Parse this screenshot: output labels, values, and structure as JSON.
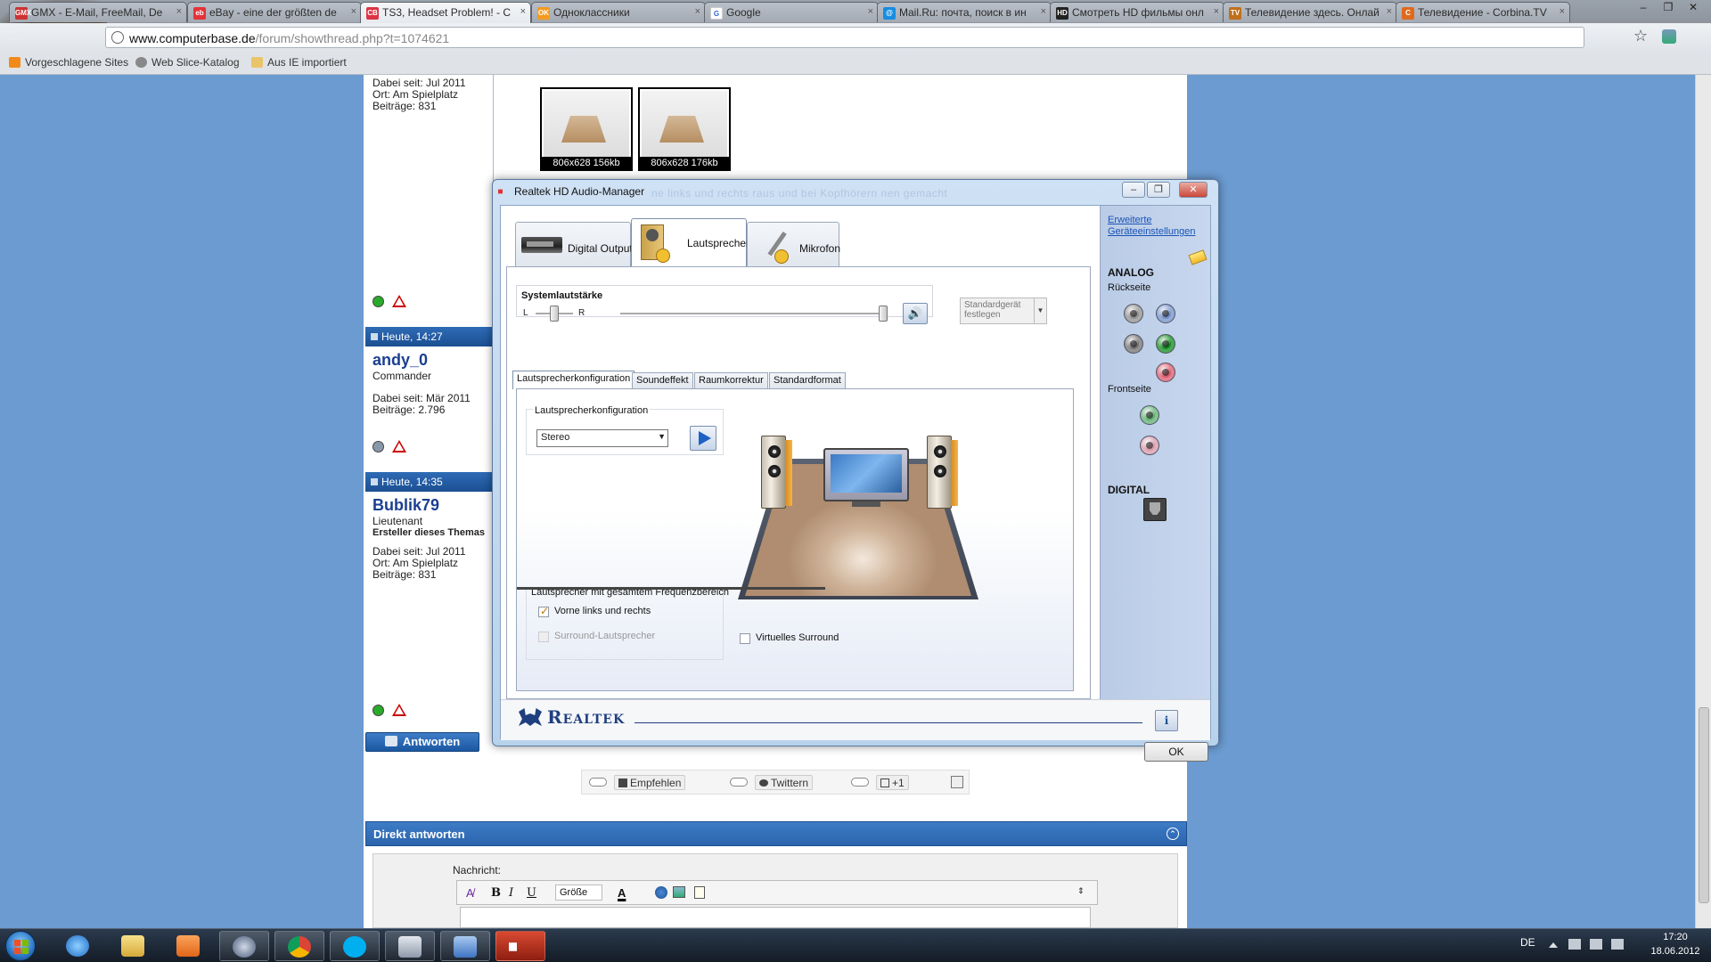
{
  "browser": {
    "tabs": [
      {
        "label": "GMX - E-Mail, FreeMail, De",
        "favicon": "GMX"
      },
      {
        "label": "eBay - eine der größten de",
        "favicon": "eb"
      },
      {
        "label": "TS3, Headset Problem! - C",
        "favicon": "CB"
      },
      {
        "label": "Одноклассники",
        "favicon": "OK"
      },
      {
        "label": "Google",
        "favicon": "G"
      },
      {
        "label": "Mail.Ru: почта, поиск в ин",
        "favicon": "@"
      },
      {
        "label": "Смотреть HD фильмы онл",
        "favicon": "HD"
      },
      {
        "label": "Телевидение здесь. Онлай",
        "favicon": "TV"
      },
      {
        "label": "Телевидение - Corbina.TV",
        "favicon": "C"
      }
    ],
    "close_glyph": "×",
    "url_domain": "www.computerbase.de",
    "url_path": "/forum/showthread.php?t=1074621",
    "bookmarks": [
      "Vorgeschlagene Sites",
      "Web Slice-Katalog",
      "Aus IE importiert"
    ],
    "window_controls": [
      "–",
      "❐",
      "✕"
    ]
  },
  "forum": {
    "post1": {
      "dabei": "Dabei seit: Jul 2011",
      "ort": "Ort: Am Spielplatz",
      "beitraege": "Beiträge: 831"
    },
    "attachments": [
      "806x628 156kb",
      "806x628 176kb"
    ],
    "post2": {
      "time": "Heute, 14:27",
      "name": "andy_0",
      "rank": "Commander",
      "dabei": "Dabei seit: Mär 2011",
      "beitraege": "Beiträge: 2.796"
    },
    "post3": {
      "time": "Heute, 14:35",
      "name": "Bublik79",
      "rank": "Lieutenant",
      "starter": "Ersteller dieses Themas",
      "dabei": "Dabei seit: Jul 2011",
      "ort": "Ort: Am Spielplatz",
      "beitraege": "Beiträge: 831"
    },
    "reply_button": "Antworten",
    "social": {
      "recommend": "Empfehlen",
      "tweet": "Twittern",
      "plusone": "+1"
    },
    "direct_reply": "Direkt antworten",
    "message_label": "Nachricht:",
    "editor": {
      "bold": "B",
      "italic": "I",
      "underline": "U",
      "size": "Größe",
      "color": "A"
    }
  },
  "dialog": {
    "title": "Realtek HD Audio-Manager",
    "ghost_text": "ne links und rechts raus und bei Kopfhörern nen gemacht",
    "tabs": [
      "Digital Output",
      "Lautsprecher",
      "Mikrofon"
    ],
    "volume": {
      "title": "Systemlautstärke",
      "left": "L",
      "right": "R",
      "level_percent": 100,
      "balance_percent": 50
    },
    "mute_icon": "🔊",
    "default_device": {
      "line1": "Standardgerät",
      "line2": "festlegen"
    },
    "subtabs": [
      "Lautsprecherkonfiguration",
      "Soundeffekt",
      "Raumkorrektur",
      "Standardformat"
    ],
    "config": {
      "label": "Lautsprecherkonfiguration",
      "selected": "Stereo"
    },
    "full_range": {
      "label": "Lautsprecher mit gesamtem Frequenzbereich",
      "front": "Vorne links und rechts",
      "surround": "Surround-Lautsprecher"
    },
    "virtual_surround": "Virtuelles Surround",
    "right": {
      "advanced_line1": "Erweiterte",
      "advanced_line2": "Geräteeinstellungen",
      "analog": "ANALOG",
      "rear": "Rückseite",
      "front": "Frontseite",
      "digital": "DIGITAL",
      "jack_colors": {
        "rear": [
          "#8e8e8e",
          "#6f8fc8",
          "#707070",
          "#0f8a1c",
          "#d9576a"
        ],
        "front": [
          "#5fae72",
          "#d799a8"
        ]
      }
    },
    "brand": "Realtek",
    "info": "i",
    "ok": "OK"
  },
  "taskbar": {
    "lang": "DE",
    "time": "17:20",
    "date": "18.06.2012"
  }
}
